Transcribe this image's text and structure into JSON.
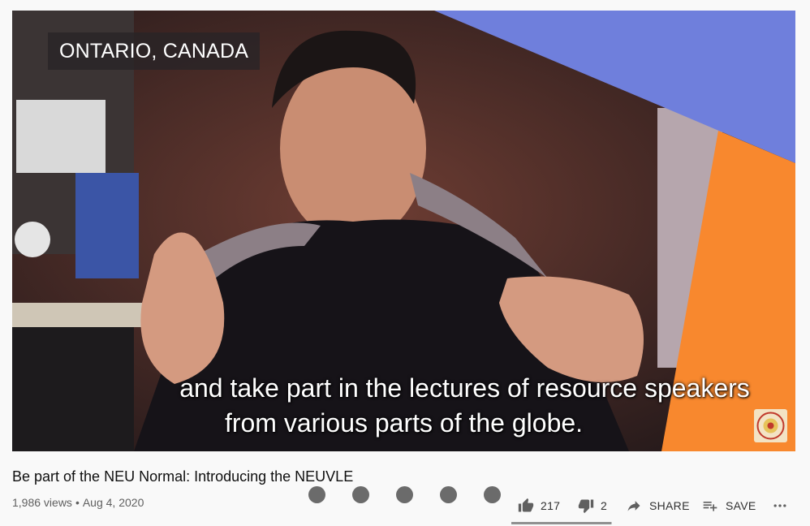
{
  "video": {
    "location_overlay": "ONTARIO, CANADA",
    "caption_line1": "and take part in the lectures of resource speakers",
    "caption_line2": "from various parts of the globe."
  },
  "info": {
    "title": "Be part of the NEU Normal: Introducing the NEUVLE",
    "views": "1,986 views",
    "separator": "•",
    "date": "Aug 4, 2020"
  },
  "actions": {
    "like_count": "217",
    "dislike_count": "2",
    "share_label": "SHARE",
    "save_label": "SAVE"
  },
  "sentiment": {
    "like_ratio": 0.99
  },
  "icons": [
    "thumb-up-icon",
    "thumb-down-icon",
    "share-icon",
    "save-playlist-icon",
    "more-icon"
  ],
  "colors": {
    "accent_blue": "#6f7fdc",
    "accent_orange": "#f8882e"
  }
}
